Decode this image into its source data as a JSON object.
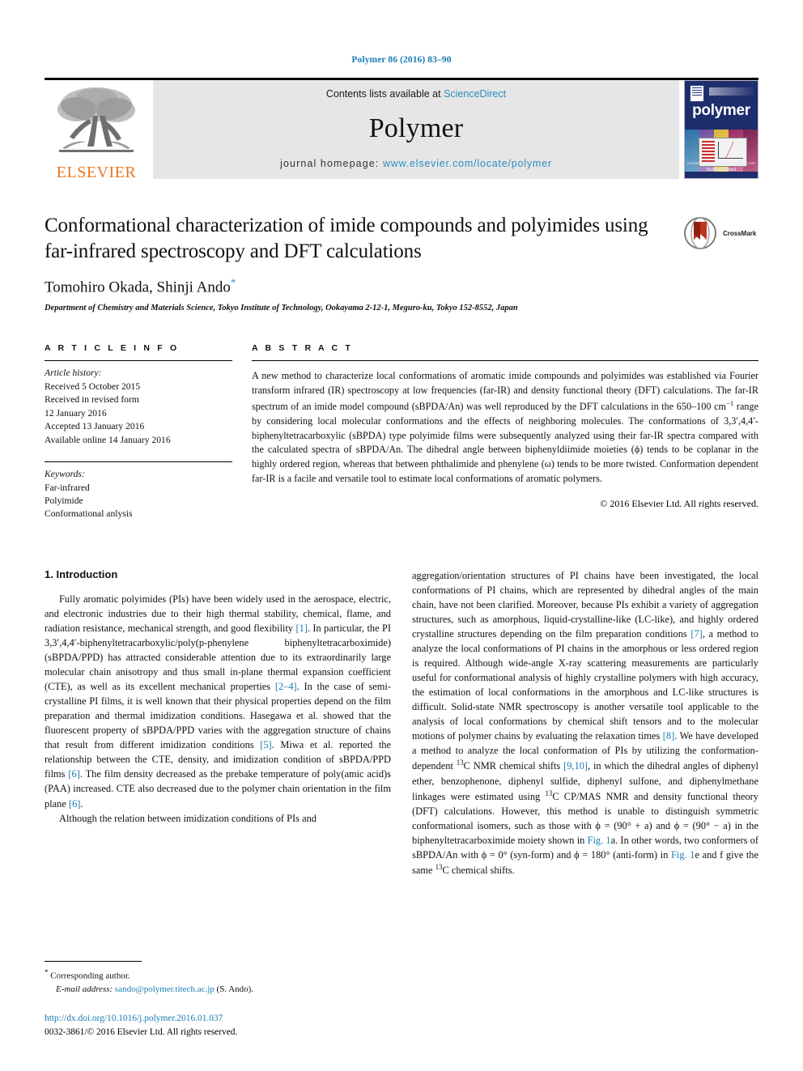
{
  "running_head": "Polymer 86 (2016) 83–90",
  "masthead": {
    "publisher": "ELSEVIER",
    "contents_prefix": "Contents lists available at ",
    "contents_link": "ScienceDirect",
    "journal_name": "Polymer",
    "homepage_prefix": "journal homepage: ",
    "homepage_url": "www.elsevier.com/locate/polymer",
    "cover_title": "polymer",
    "cover_footer_1": "Available online at www.sciencedirect.com",
    "cover_footer_2": "ScienceDirect"
  },
  "article": {
    "title": "Conformational characterization of imide compounds and polyimides using far-infrared spectroscopy and DFT calculations",
    "authors": "Tomohiro Okada, Shinji Ando",
    "corresponding_marker": "*",
    "affiliation": "Department of Chemistry and Materials Science, Tokyo Institute of Technology, Ookayama 2-12-1, Meguro-ku, Tokyo 152-8552, Japan",
    "crossmark_label": "CrossMark"
  },
  "article_info": {
    "heading": "A R T I C L E   I N F O",
    "history_label": "Article history:",
    "history": [
      "Received 5 October 2015",
      "Received in revised form",
      "12 January 2016",
      "Accepted 13 January 2016",
      "Available online 14 January 2016"
    ],
    "keywords_label": "Keywords:",
    "keywords": [
      "Far-infrared",
      "Polyimide",
      "Conformational anlysis"
    ]
  },
  "abstract": {
    "heading": "A B S T R A C T",
    "text_1": "A new method to characterize local conformations of aromatic imide compounds and polyimides was established via Fourier transform infrared (IR) spectroscopy at low frequencies (far-IR) and density functional theory (DFT) calculations. The far-IR spectrum of an imide model compound (sBPDA/An) was well reproduced by the DFT calculations in the 650–100 cm",
    "text_sup": "−1",
    "text_2": " range by considering local molecular conformations and the effects of neighboring molecules. The conformations of 3,3′,4,4′-biphenyltetracarboxylic (sBPDA) type polyimide films were subsequently analyzed using their far-IR spectra compared with the calculated spectra of sBPDA/An. The dihedral angle between biphenyldiimide moieties (ϕ) tends to be coplanar in the highly ordered region, whereas that between phthalimide and phenylene (ω) tends to be more twisted. Conformation dependent far-IR is a facile and versatile tool to estimate local conformations of aromatic polymers.",
    "copyright": "© 2016 Elsevier Ltd. All rights reserved."
  },
  "intro": {
    "heading": "1. Introduction",
    "left_p1_a": "Fully aromatic polyimides (PIs) have been widely used in the aerospace, electric, and electronic industries due to their high thermal stability, chemical, flame, and radiation resistance, mechanical strength, and good flexibility ",
    "ref_1": "[1]",
    "left_p1_b": ". In particular, the PI 3,3′,4,4′-biphenyltetracarboxylic/poly(p-phenylene biphenyltetracarboximide) (sBPDA/PPD) has attracted considerable attention due to its extraordinarily large molecular chain anisotropy and thus small in-plane thermal expansion coefficient (CTE), as well as its excellent mechanical properties ",
    "ref_2_4": "[2–4]",
    "left_p1_c": ". In the case of semi-crystalline PI films, it is well known that their physical properties depend on the film preparation and thermal imidization conditions. Hasegawa et al. showed that the fluorescent property of sBPDA/PPD varies with the aggregation structure of chains that result from different imidization conditions ",
    "ref_5": "[5]",
    "left_p1_d": ". Miwa et al. reported the relationship between the CTE, density, and imidization condition of sBPDA/PPD films ",
    "ref_6": "[6]",
    "left_p1_e": ". The film density decreased as the prebake temperature of poly(amic acid)s (PAA) increased. CTE also decreased due to the polymer chain orientation in the film plane ",
    "ref_6b": "[6]",
    "left_p1_f": ".",
    "left_p2": "Although the relation between imidization conditions of PIs and",
    "right_p1_a": "aggregation/orientation structures of PI chains have been investigated, the local conformations of PI chains, which are represented by dihedral angles of the main chain, have not been clarified. Moreover, because PIs exhibit a variety of aggregation structures, such as amorphous, liquid-crystalline-like (LC-like), and highly ordered crystalline structures depending on the film preparation conditions ",
    "ref_7": "[7]",
    "right_p1_b": ", a method to analyze the local conformations of PI chains in the amorphous or less ordered region is required. Although wide-angle X-ray scattering measurements are particularly useful for conformational analysis of highly crystalline polymers with high accuracy, the estimation of local conformations in the amorphous and LC-like structures is difficult. Solid-state NMR spectroscopy is another versatile tool applicable to the analysis of local conformations by chemical shift tensors and to the molecular motions of polymer chains by evaluating the relaxation times ",
    "ref_8": "[8]",
    "right_p1_c": ". We have developed a method to analyze the local conformation of PIs by utilizing the conformation-dependent ",
    "sup_13c_1": "13",
    "right_p1_d": "C NMR chemical shifts ",
    "ref_9_10": "[9,10]",
    "right_p1_e": ", in which the dihedral angles of diphenyl ether, benzophenone, diphenyl sulfide, diphenyl sulfone, and diphenylmethane linkages were estimated using ",
    "sup_13c_2": "13",
    "right_p1_f": "C CP/MAS NMR and density functional theory (DFT) calculations. However, this method is unable to distinguish symmetric conformational isomers, such as those with ϕ = (90° + a) and ϕ = (90° − a) in the biphenyltetracarboximide moiety shown in ",
    "fig_1a": "Fig. 1",
    "right_p1_g": "a. In other words, two conformers of sBPDA/An with ϕ = 0° (syn-form) and ϕ = 180° (anti-form) in ",
    "fig_1e": "Fig. 1",
    "right_p1_h": "e and f give the same ",
    "sup_13c_3": "13",
    "right_p1_i": "C chemical shifts."
  },
  "footnote": {
    "star": "*",
    "corresponding": "Corresponding author.",
    "email_label": "E-mail address:",
    "email": "sando@polymer.titech.ac.jp",
    "email_suffix": "(S. Ando).",
    "doi": "http://dx.doi.org/10.1016/j.polymer.2016.01.037",
    "issn_line": "0032-3861/© 2016 Elsevier Ltd. All rights reserved."
  },
  "colors": {
    "link": "#1a7cb5",
    "elsevier_orange": "#E87722",
    "cover_blue": "#1e2d6b"
  }
}
